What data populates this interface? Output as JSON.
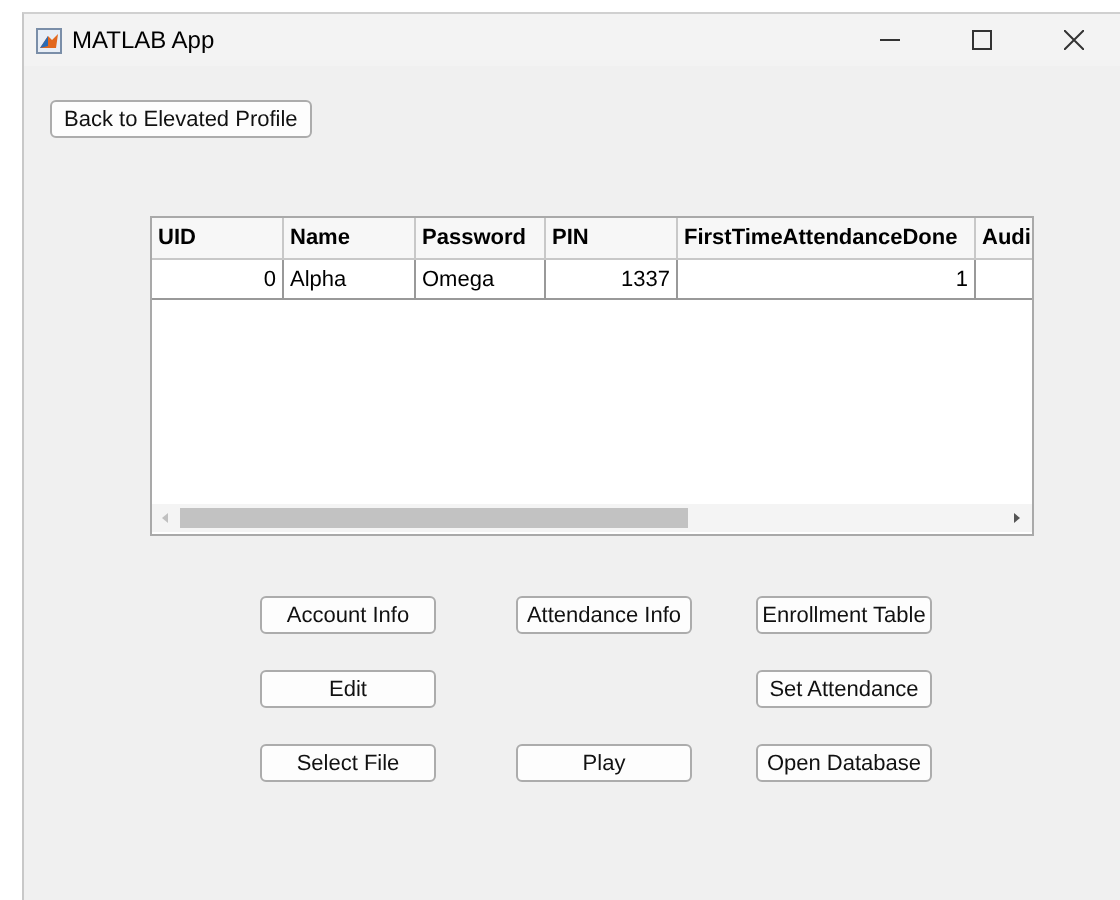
{
  "window": {
    "title": "MATLAB App"
  },
  "back_button": "Back to Elevated Profile",
  "table": {
    "columns": [
      "UID",
      "Name",
      "Password",
      "PIN",
      "FirstTimeAttendanceDone",
      "Audi"
    ],
    "rows": [
      [
        "0",
        "Alpha",
        "Omega",
        "1337",
        "1",
        ""
      ]
    ]
  },
  "button_grid": [
    {
      "column_1": "Account Info",
      "column_2": "Attendance Info",
      "column_3": "Enrollment Table"
    },
    {
      "column_1": "Edit",
      "column_3": "Set Attendance"
    },
    {
      "column_1": "Select File",
      "column_2": "Play",
      "column_3": "Open Database"
    }
  ]
}
